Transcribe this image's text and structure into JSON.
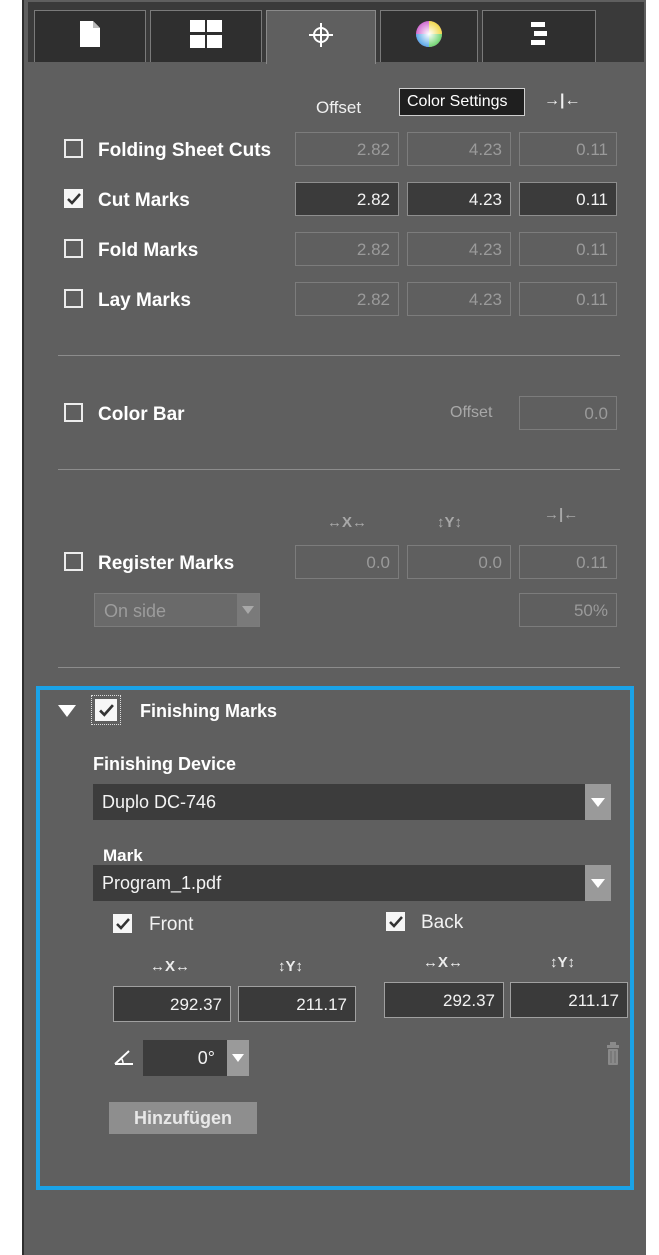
{
  "tabs": [
    {
      "icon": "document-icon",
      "active": false
    },
    {
      "icon": "layout-icon",
      "active": false
    },
    {
      "icon": "crosshair-icon",
      "active": true
    },
    {
      "icon": "color-wheel-icon",
      "active": false
    },
    {
      "icon": "align-icon",
      "active": false
    }
  ],
  "marks_header": {
    "offset": "Offset",
    "tooltip": "Color Settings",
    "bleed_icon": "→|←"
  },
  "marks": [
    {
      "label": "Folding Sheet Cuts",
      "checked": false,
      "v1": "2.82",
      "v2": "4.23",
      "v3": "0.11"
    },
    {
      "label": "Cut Marks",
      "checked": true,
      "v1": "2.82",
      "v2": "4.23",
      "v3": "0.11"
    },
    {
      "label": "Fold Marks",
      "checked": false,
      "v1": "2.82",
      "v2": "4.23",
      "v3": "0.11"
    },
    {
      "label": "Lay Marks",
      "checked": false,
      "v1": "2.82",
      "v2": "4.23",
      "v3": "0.11"
    }
  ],
  "color_bar": {
    "label": "Color Bar",
    "checked": false,
    "offset_label": "Offset",
    "offset_value": "0.0"
  },
  "register": {
    "x_label": "↔X↔",
    "y_label": "↕Y↕",
    "bleed_icon": "→|←",
    "label": "Register Marks",
    "checked": false,
    "x": "0.0",
    "y": "0.0",
    "bleed": "0.11",
    "position": "On side",
    "scale": "50%"
  },
  "finishing": {
    "label": "Finishing Marks",
    "checked": true,
    "expanded": true,
    "device_label": "Finishing Device",
    "device": "Duplo DC-746",
    "mark_label": "Mark",
    "mark": "Program_1.pdf",
    "front_label": "Front",
    "front_checked": true,
    "back_label": "Back",
    "back_checked": true,
    "x_label": "↔X↔",
    "y_label": "↕Y↕",
    "front_x": "292.37",
    "front_y": "211.17",
    "back_x": "292.37",
    "back_y": "211.17",
    "angle": "0°",
    "add_button": "Hinzufügen"
  },
  "colors": {
    "accent": "#1aa3e8",
    "panel": "#5f5f5f"
  }
}
